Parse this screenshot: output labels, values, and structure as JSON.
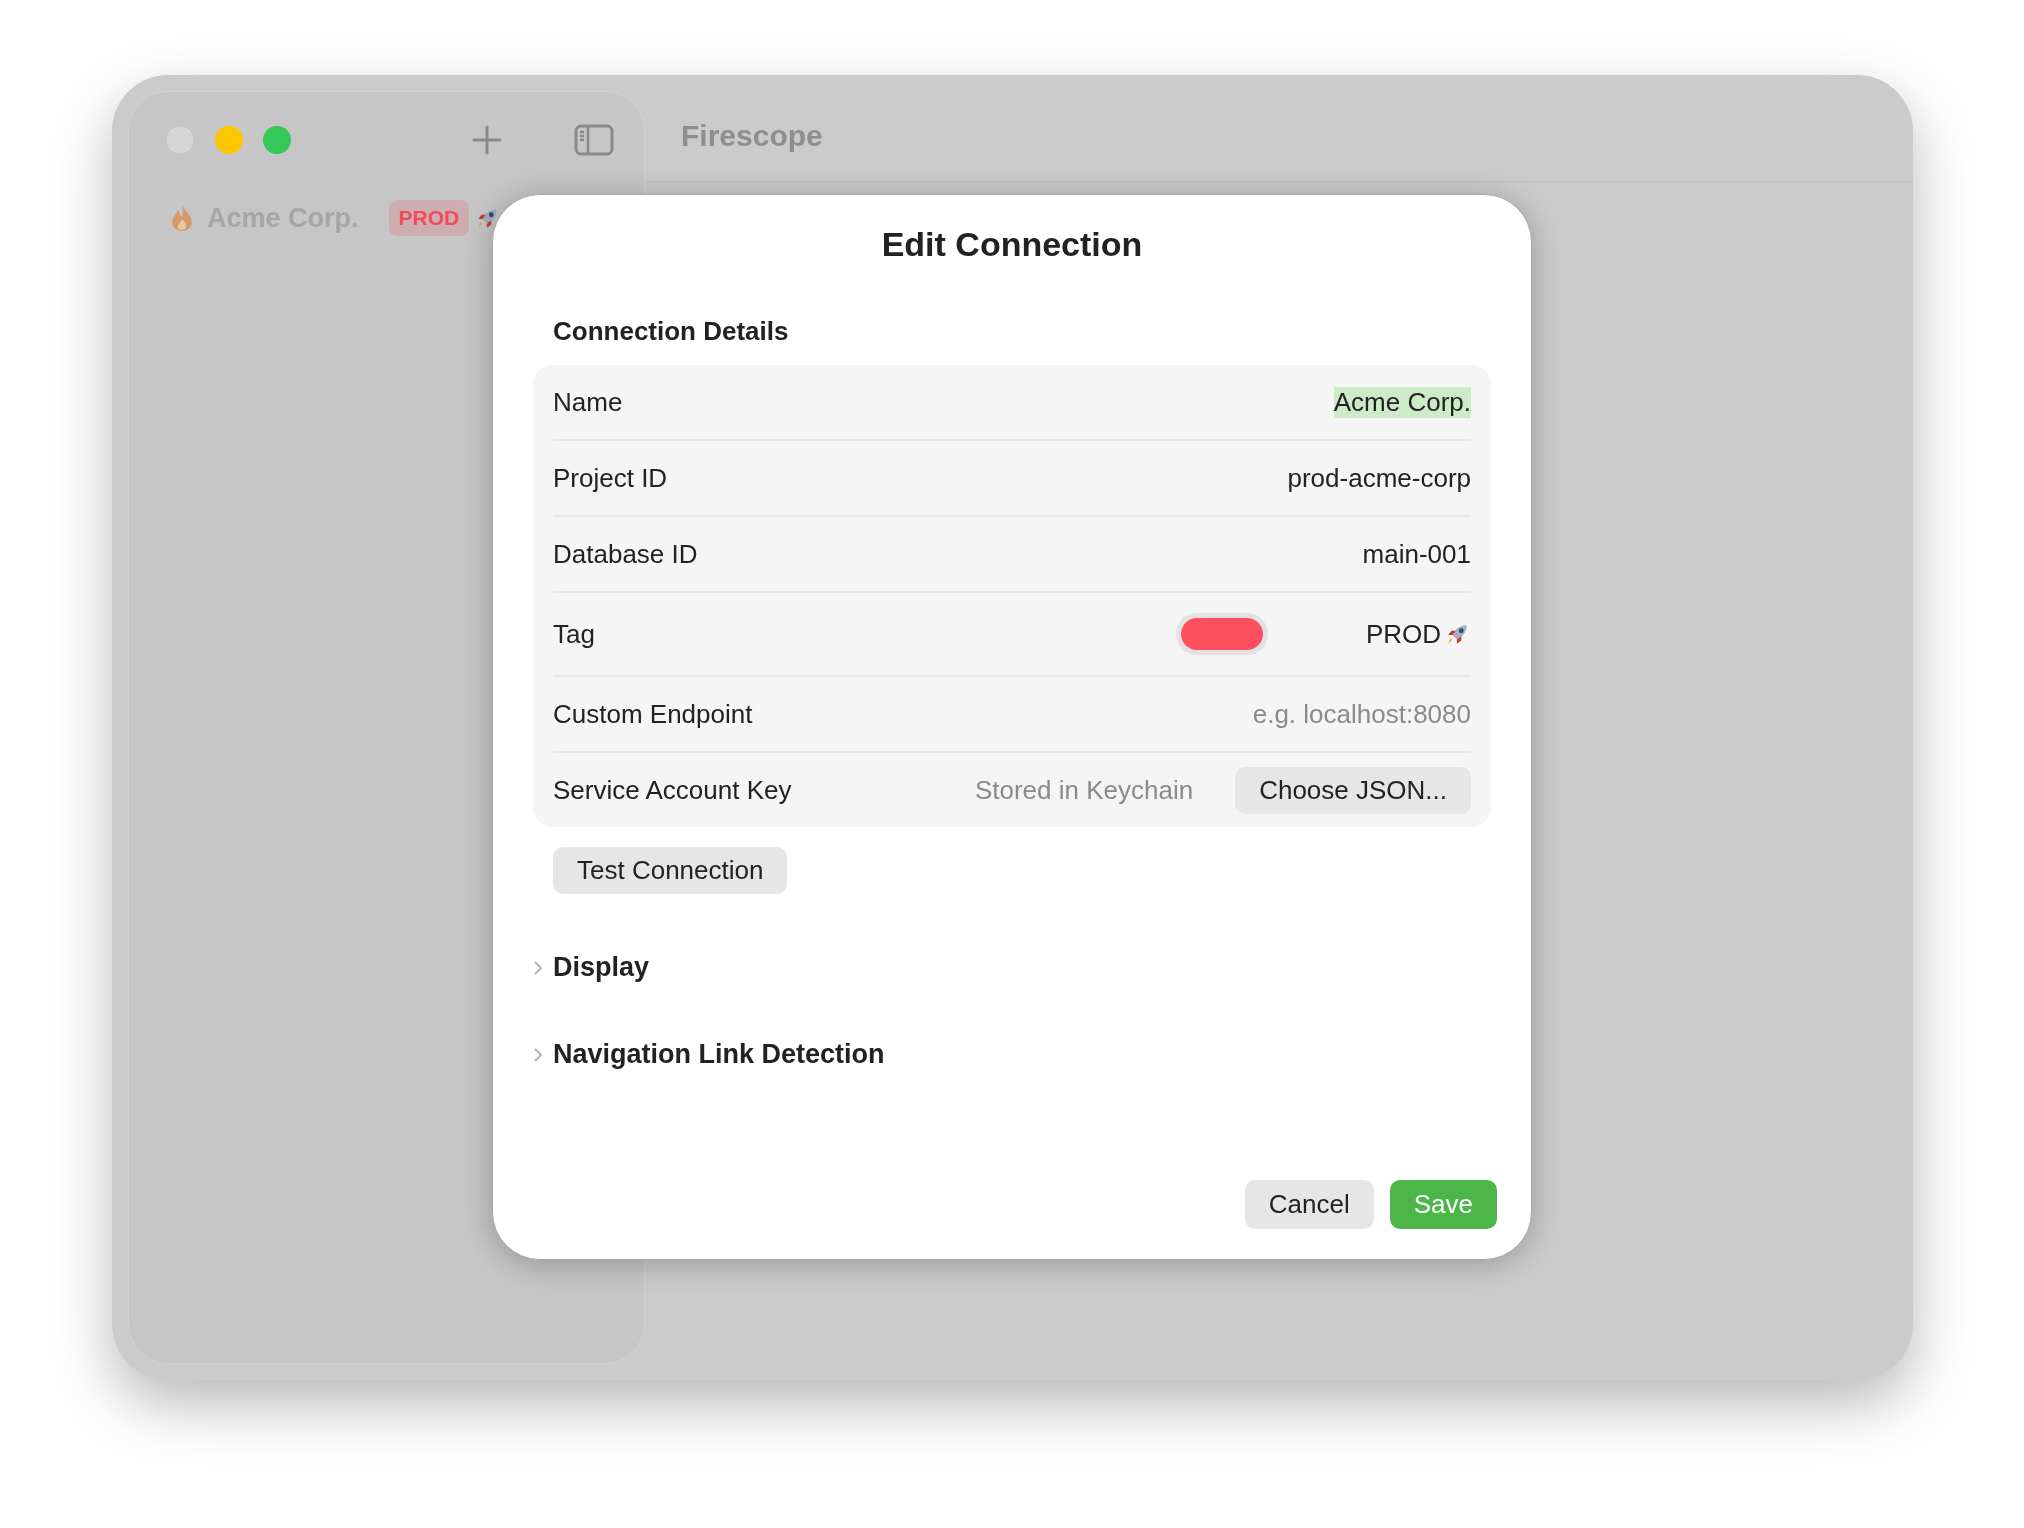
{
  "window": {
    "title": "Firescope"
  },
  "sidebar": {
    "items": [
      {
        "name": "Acme Corp.",
        "tag": "PROD",
        "color": "#f24b5b"
      }
    ]
  },
  "dialog": {
    "title": "Edit Connection",
    "section": "Connection Details",
    "fields": [
      {
        "kind": "text",
        "label": "Name",
        "value": "Acme Corp.",
        "selected": true
      },
      {
        "kind": "text",
        "label": "Project ID",
        "value": "prod-acme-corp",
        "selected": false
      },
      {
        "kind": "text",
        "label": "Database ID",
        "value": "main-001",
        "selected": false
      },
      {
        "kind": "tag",
        "label": "Tag",
        "color": "#fe4f5e",
        "value": "PROD"
      },
      {
        "kind": "placeholder",
        "label": "Custom Endpoint",
        "placeholder": "e.g. localhost:8080"
      },
      {
        "kind": "file",
        "label": "Service Account Key",
        "status": "Stored in Keychain",
        "button": "Choose JSON..."
      }
    ],
    "test_button": "Test Connection",
    "disclosures": [
      {
        "label": "Display",
        "expanded": false
      },
      {
        "label": "Navigation Link Detection",
        "expanded": false
      }
    ],
    "buttons": [
      {
        "label": "Cancel",
        "kind": "secondary"
      },
      {
        "label": "Save",
        "kind": "primary"
      }
    ]
  }
}
